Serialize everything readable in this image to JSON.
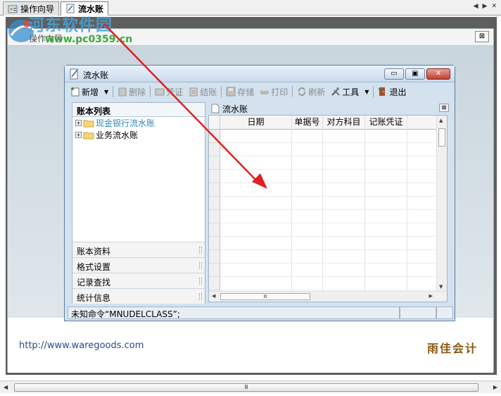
{
  "tabs": [
    {
      "label": "操作向导",
      "icon": "wizard-icon"
    },
    {
      "label": "流水账",
      "icon": "ledger-icon"
    }
  ],
  "watermark": {
    "title": "河东软件园",
    "url": "www.pc0359.cn"
  },
  "wizard_panel": {
    "title": "操作向导",
    "close_label": "⊠",
    "footer_url": "http://www.waregoods.com",
    "footer_brand": "雨佳会计"
  },
  "window": {
    "title": "流水账",
    "buttons": {
      "minimize": "▭",
      "maximize": "▣",
      "close": "✕"
    }
  },
  "toolbar": [
    {
      "label": "新增",
      "icon": "add-icon",
      "enabled": true,
      "dropdown": true
    },
    {
      "label": "删除",
      "icon": "delete-icon",
      "enabled": false
    },
    {
      "label": "凭证",
      "icon": "voucher-icon",
      "enabled": false
    },
    {
      "label": "结账",
      "icon": "close-account-icon",
      "enabled": false
    },
    {
      "label": "存储",
      "icon": "save-icon",
      "enabled": false
    },
    {
      "label": "打印",
      "icon": "print-icon",
      "enabled": false
    },
    {
      "label": "刷新",
      "icon": "refresh-icon",
      "enabled": false
    },
    {
      "label": "工具",
      "icon": "tools-icon",
      "enabled": true,
      "dropdown": true
    },
    {
      "label": "退出",
      "icon": "exit-icon",
      "enabled": true
    }
  ],
  "account_list": {
    "header": "账本列表",
    "tree": [
      {
        "label": "现金银行流水账",
        "expand": "+",
        "selected": true
      },
      {
        "label": "业务流水账",
        "expand": "+",
        "selected": false
      }
    ],
    "nav": [
      "账本资料",
      "格式设置",
      "记录查找",
      "统计信息"
    ]
  },
  "ledger": {
    "header": "流水账",
    "columns": [
      "日期",
      "单据号",
      "对方科目",
      "记账凭证"
    ],
    "scroll_thumb": "Ⅲ"
  },
  "statusbar": {
    "message": "未知命令“MNUDELCLASS”;",
    "cell2": "",
    "cell3": ""
  },
  "outer_scroll": {
    "thumb": "Ⅲ"
  },
  "colors": {
    "arrow": "#e02020",
    "window_close": "#c24030",
    "tree_link": "#3388bb",
    "brand": "#8a5a10"
  }
}
